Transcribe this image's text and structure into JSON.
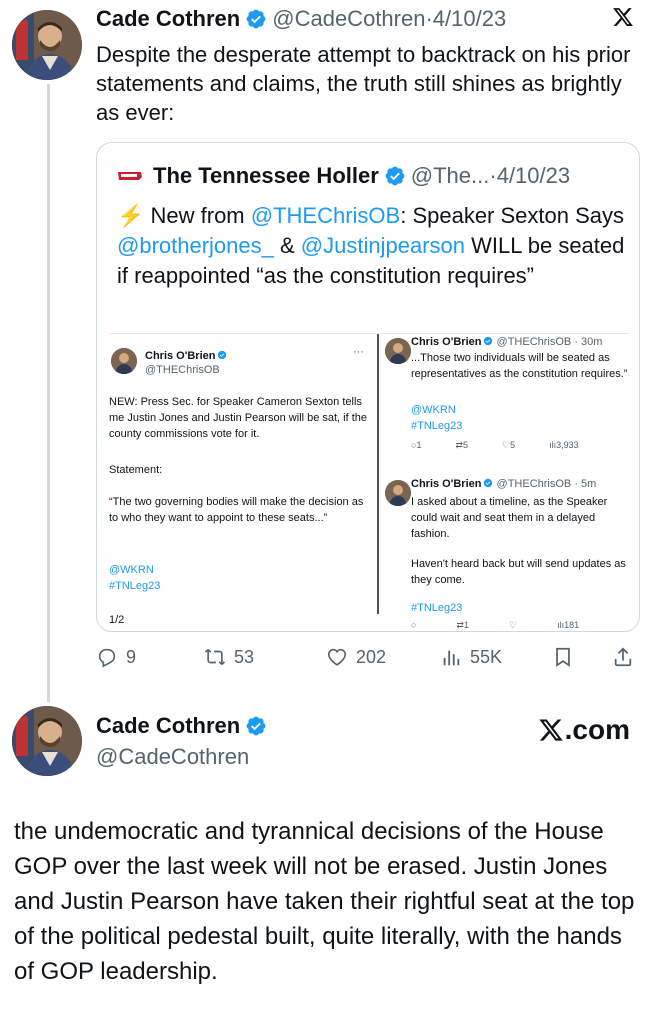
{
  "tweet1": {
    "name": "Cade Cothren",
    "handle": "@CadeCothren",
    "separator": "·",
    "date": "4/10/23",
    "text": "Despite the desperate attempt to backtrack on his prior statements and claims, the truth still shines as brightly as ever:",
    "actions": {
      "replies": "9",
      "retweets": "53",
      "likes": "202",
      "views": "55K"
    }
  },
  "quote": {
    "name": "The Tennessee Holler",
    "handle": "@The...",
    "separator": "·",
    "date": "4/10/23",
    "text_prefix": "⚡️ New from ",
    "mention1": "@THEChrisOB",
    "text_mid1": ": Speaker Sexton Says ",
    "mention2": "@brotherjones_",
    "text_mid2": " & ",
    "mention3": "@Justinjpearson",
    "text_suffix": " WILL be seated if reappointed “as the constitution requires”"
  },
  "screenshot": {
    "left": {
      "name": "Chris O'Brien",
      "handle": "@THEChrisOB",
      "more": "···",
      "para1": "NEW: Press Sec. for Speaker Cameron Sexton tells me Justin Jones and Justin Pearson will be sat, if the county commissions vote for it.",
      "para2": "Statement:",
      "para3": "“The two governing bodies will make the decision as to who they want to appoint to these seats...”",
      "link1": "@WKRN",
      "link2": "#TNLeg23",
      "page": "1/2"
    },
    "right1": {
      "name": "Chris O'Brien",
      "handle": "@THEChrisOB · 30m",
      "text": "...Those two individuals will be seated as representatives as the constitution requires.”",
      "link1": "@WKRN",
      "link2": "#TNLeg23",
      "replies": "1",
      "retweets": "5",
      "likes": "5",
      "views": "3,933"
    },
    "right2": {
      "name": "Chris O'Brien",
      "handle": "@THEChrisOB · 5m",
      "text1": "I asked about a timeline, as the Speaker could wait and seat them in a delayed fashion.",
      "text2": "Haven't heard back but will send updates as they come.",
      "link": "#TNLeg23",
      "retweets": "1",
      "views": "181"
    }
  },
  "tweet2": {
    "name": "Cade Cothren",
    "handle": "@CadeCothren",
    "brand": ".com",
    "text": "the undemocratic and tyrannical decisions of the House GOP over the last week will not be erased. Justin Jones and Justin Pearson have taken their rightful seat at the top of the political pedestal built, quite literally, with the hands of GOP leadership."
  },
  "colors": {
    "link": "#1d9bf0",
    "muted": "#536471",
    "verified": "#1d9bf0",
    "border": "#cfd9de"
  },
  "icons": [
    "verified-badge-icon",
    "x-logo-icon",
    "reply-icon",
    "retweet-icon",
    "like-icon",
    "views-icon",
    "bookmark-icon",
    "share-icon",
    "tennessee-holler-logo"
  ]
}
